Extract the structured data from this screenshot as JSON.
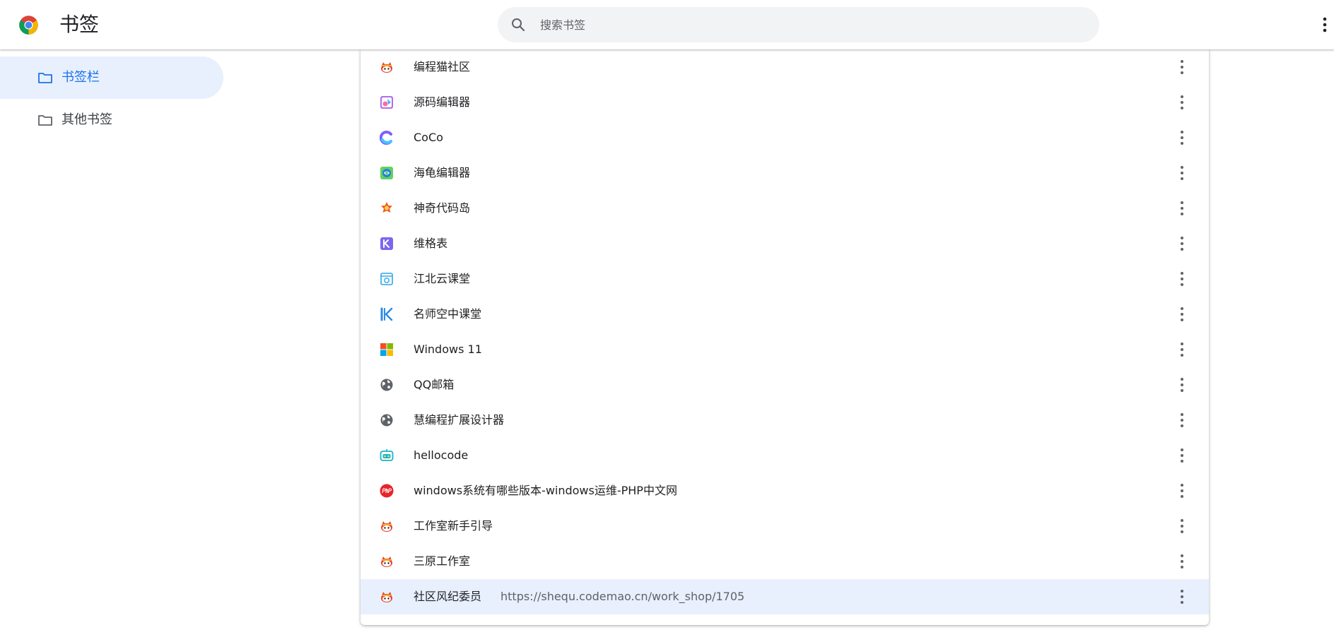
{
  "header": {
    "title": "书签",
    "search_placeholder": "搜索书签",
    "search_value": ""
  },
  "sidebar": {
    "items": [
      {
        "label": "书签栏",
        "selected": true
      },
      {
        "label": "其他书签",
        "selected": false
      }
    ]
  },
  "bookmarks": [
    {
      "title": "编程猫社区",
      "icon": "codemao-icon"
    },
    {
      "title": "源码编辑器",
      "icon": "source-editor-icon"
    },
    {
      "title": "CoCo",
      "icon": "coco-icon"
    },
    {
      "title": "海龟编辑器",
      "icon": "turtle-editor-icon"
    },
    {
      "title": "神奇代码岛",
      "icon": "code-island-icon"
    },
    {
      "title": "维格表",
      "icon": "vika-icon"
    },
    {
      "title": "江北云课堂",
      "icon": "cloud-classroom-icon"
    },
    {
      "title": "名师空中课堂",
      "icon": "k-logo-icon"
    },
    {
      "title": "Windows 11",
      "icon": "windows-logo-icon"
    },
    {
      "title": "QQ邮箱",
      "icon": "globe-icon"
    },
    {
      "title": "慧编程扩展设计器",
      "icon": "globe-icon"
    },
    {
      "title": "hellocode",
      "icon": "robot-icon"
    },
    {
      "title": "windows系统有哪些版本-windows运维-PHP中文网",
      "icon": "php-icon"
    },
    {
      "title": "工作室新手引导",
      "icon": "codemao-icon"
    },
    {
      "title": "三原工作室",
      "icon": "codemao-icon"
    },
    {
      "title": "社区风纪委员",
      "icon": "codemao-icon",
      "url": "https://shequ.codemao.cn/work_shop/1705",
      "selected": true
    }
  ],
  "colors": {
    "accent": "#1a73e8",
    "selected_bg": "#e8f0fe",
    "search_bg": "#f1f3f4",
    "icon_gray": "#5f6368"
  }
}
